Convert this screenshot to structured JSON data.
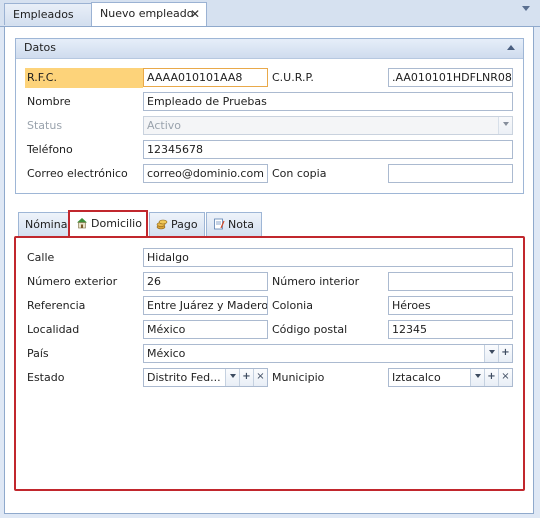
{
  "doc_tabs": [
    {
      "label": "Empleados"
    },
    {
      "label": "Nuevo empleado"
    }
  ],
  "group": {
    "title": "Datos",
    "rfc_label": "R.F.C.",
    "rfc_value": "AAAA010101AA8",
    "curp_label": "C.U.R.P.",
    "curp_value": ".AA010101HDFLNR08",
    "nombre_label": "Nombre",
    "nombre_value": "Empleado de Pruebas",
    "status_label": "Status",
    "status_value": "Activo",
    "telefono_label": "Teléfono",
    "telefono_value": "12345678",
    "correo_label": "Correo electrónico",
    "correo_value": "correo@dominio.com",
    "copia_label": "Con copia",
    "copia_value": ""
  },
  "sub_tabs": [
    {
      "label": "Nómina"
    },
    {
      "label": "Domicilio"
    },
    {
      "label": "Pago"
    },
    {
      "label": "Nota"
    }
  ],
  "domicilio": {
    "calle_label": "Calle",
    "calle_value": "Hidalgo",
    "num_ext_label": "Número exterior",
    "num_ext_value": "26",
    "num_int_label": "Número  interior",
    "num_int_value": "",
    "referencia_label": "Referencia",
    "referencia_value": "Entre Juárez y Madero",
    "colonia_label": "Colonia",
    "colonia_value": "Héroes",
    "localidad_label": "Localidad",
    "localidad_value": "México",
    "cp_label": "Código postal",
    "cp_value": "12345",
    "pais_label": "País",
    "pais_value": "México",
    "estado_label": "Estado",
    "estado_value": "Distrito Fed...",
    "municipio_label": "Municipio",
    "municipio_value": "Iztacalco"
  },
  "icons": {
    "close": "close-icon",
    "menu": "chevron-down-icon",
    "collapse": "chevron-up-icon",
    "add": "+",
    "clear": "×"
  },
  "colors": {
    "highlight": "#c1272d",
    "focus_fill": "#fdd37a"
  }
}
